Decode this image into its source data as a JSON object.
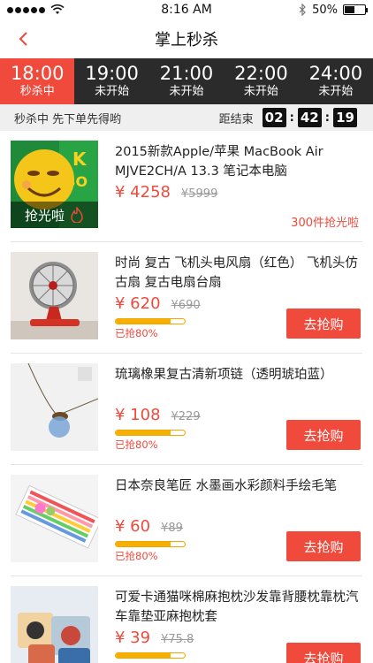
{
  "status_bar": {
    "carrier_dots": 5,
    "time": "8:16 AM",
    "battery": "50%",
    "battery_level": 0.5
  },
  "nav": {
    "title": "掌上秒杀",
    "back_icon": "chevron-left-icon"
  },
  "tabs": [
    {
      "time": "18:00",
      "status": "秒杀中",
      "active": true
    },
    {
      "time": "19:00",
      "status": "未开始",
      "active": false
    },
    {
      "time": "21:00",
      "status": "未开始",
      "active": false
    },
    {
      "time": "22:00",
      "status": "未开始",
      "active": false
    },
    {
      "time": "24:00",
      "status": "未开始",
      "active": false
    }
  ],
  "countdown": {
    "left_text": "秒杀中 先下单先得哟",
    "label": "距结束",
    "hh": "02",
    "mm": "42",
    "ss": "19"
  },
  "products": [
    {
      "name": "2015新款Apple/苹果 MacBook Air MJVE2CH/A 13.3 笔记本电脑",
      "price": "¥ 4258",
      "old_price": "¥5999",
      "sold_out": true,
      "sold_overlay": "抢光啦",
      "sold_text": "300件抢光啦"
    },
    {
      "name": "时尚 复古 飞机头电风扇（红色） 飞机头仿古扇 复古电扇台扇",
      "price": "¥ 620",
      "old_price": "¥690",
      "progress": 0.8,
      "progress_text": "已抢80%",
      "button": "去抢购"
    },
    {
      "name": "琉璃橡果复古清新项链（透明琥珀蓝）",
      "price": "¥ 108",
      "old_price": "¥229",
      "progress": 0.8,
      "progress_text": "已抢80%",
      "button": "去抢购"
    },
    {
      "name": "日本奈良笔匠 水墨画水彩颜料手绘毛笔",
      "price": "¥ 60",
      "old_price": "¥89",
      "progress": 0.8,
      "progress_text": "已抢80%",
      "button": "去抢购"
    },
    {
      "name": "可爱卡通猫咪棉麻抱枕沙发靠背腰枕靠枕汽车靠垫亚麻抱枕套",
      "price": "¥ 39",
      "old_price": "¥75.8",
      "progress": 0.8,
      "button": "去抢购"
    }
  ],
  "colors": {
    "accent": "#f04a3c",
    "tab_bg": "#2b2b2b",
    "progress": "#f5b000"
  }
}
